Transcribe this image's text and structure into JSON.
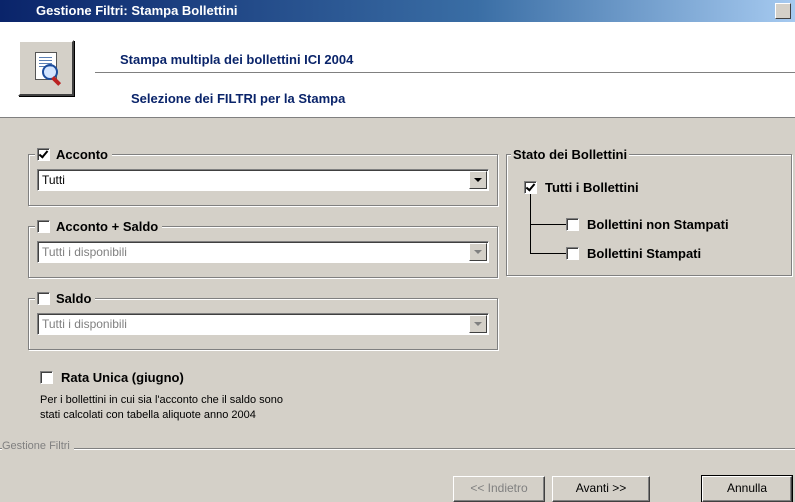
{
  "window": {
    "title": "Gestione Filtri: Stampa Bollettini"
  },
  "header": {
    "line1": "Stampa multipla dei bollettini ICI 2004",
    "line2": "Selezione dei FILTRI per la Stampa",
    "icon": "print-preview-icon"
  },
  "filters": {
    "acconto": {
      "label": "Acconto",
      "checked": true,
      "value": "Tutti"
    },
    "acconto_saldo": {
      "label": "Acconto + Saldo",
      "checked": false,
      "value": "Tutti i disponibili"
    },
    "saldo": {
      "label": "Saldo",
      "checked": false,
      "value": "Tutti i disponibili"
    },
    "rata_unica": {
      "label": "Rata Unica (giugno)",
      "checked": false
    },
    "note_line1": "Per i bollettini in cui sia l'acconto che il saldo sono",
    "note_line2": "stati calcolati con tabella aliquote anno 2004"
  },
  "stato": {
    "title": "Stato dei Bollettini",
    "tutti": {
      "label": "Tutti i Bollettini",
      "checked": true
    },
    "non_stampati": {
      "label": "Bollettini non Stampati",
      "checked": false
    },
    "stampati": {
      "label": "Bollettini Stampati",
      "checked": false
    }
  },
  "footer": {
    "group_label": "Gestione Filtri",
    "indietro": "<< Indietro",
    "avanti": "Avanti >>",
    "annulla": "Annulla"
  }
}
